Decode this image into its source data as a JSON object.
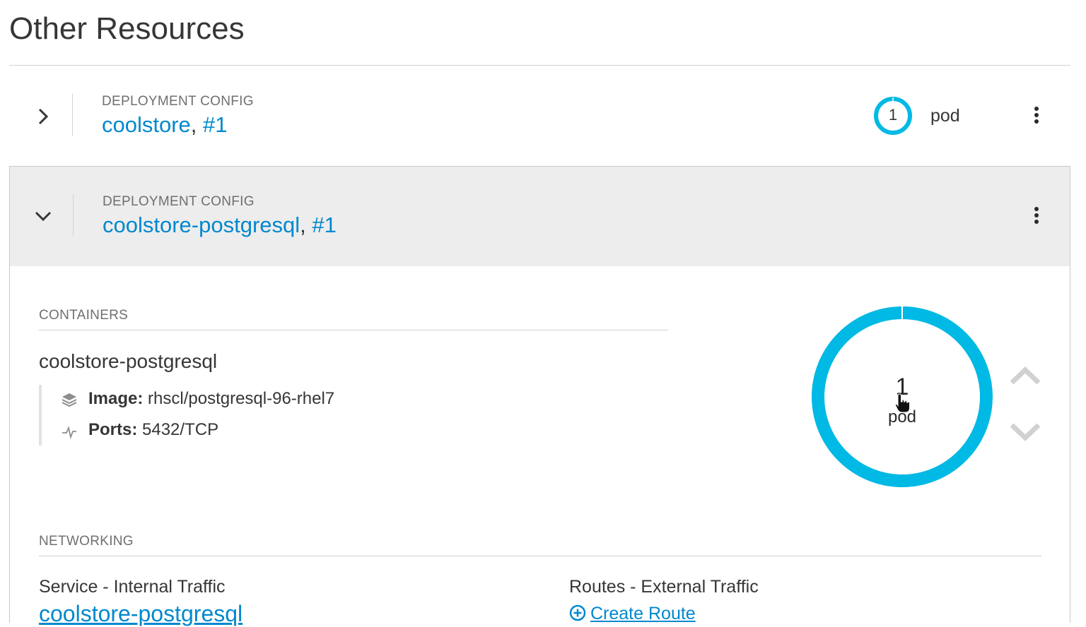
{
  "section": {
    "title": "Other Resources"
  },
  "rows": [
    {
      "kind_label": "DEPLOYMENT CONFIG",
      "name": "coolstore",
      "separator": ",",
      "revision": "#1",
      "expanded": false,
      "pods": {
        "count": "1",
        "label": "pod"
      }
    },
    {
      "kind_label": "DEPLOYMENT CONFIG",
      "name": "coolstore-postgresql",
      "separator": ",",
      "revision": "#1",
      "expanded": true
    }
  ],
  "details": {
    "containers_heading": "CONTAINERS",
    "container": {
      "name": "coolstore-postgresql",
      "image_label": "Image:",
      "image_value": "rhscl/postgresql-96-rhel7",
      "ports_label": "Ports:",
      "ports_value": "5432/TCP"
    },
    "pod_donut": {
      "count": "1",
      "label": "pod"
    },
    "networking_heading": "NETWORKING",
    "service_heading": "Service - Internal Traffic",
    "service_link": "coolstore-postgresql",
    "routes_heading": "Routes - External Traffic",
    "create_route": "Create Route"
  },
  "colors": {
    "accent": "#0088ce",
    "donut": "#00b9e4",
    "expanded_row_bg": "#ededed"
  },
  "icons": {
    "row1_toggle": "chevron-right-icon",
    "row2_toggle": "chevron-down-icon",
    "kebab": "kebab-menu-icon",
    "image": "layers-icon",
    "ports": "pulse-icon",
    "scale_up": "chevron-up-icon",
    "scale_down": "chevron-down-icon",
    "create_route": "plus-circle-icon"
  }
}
